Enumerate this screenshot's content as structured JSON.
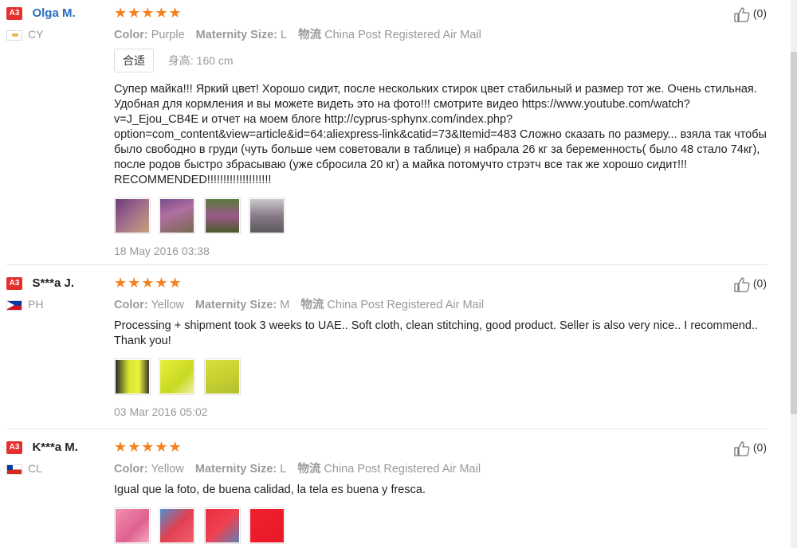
{
  "helpful_label": "(0)",
  "reviews": [
    {
      "badge": "A3",
      "name": "Olga M.",
      "country": "CY",
      "stars": "★★★★★",
      "color_label": "Color:",
      "color_value": "Purple",
      "size_label": "Maternity Size:",
      "size_value": "L",
      "ship_label": "物流",
      "ship_value": "China Post Registered Air Mail",
      "fit_tag": "合适",
      "height_label": "身高:",
      "height_value": "160 cm",
      "text": "Супер майка!!! Яркий цвет! Хорошо сидит, после нескольких стирок цвет стабильный и размер тот же. Очень стильная. Удобная для кормления и вы можете видеть это на фото!!! смотрите видео https://www.youtube.com/watch?v=J_Ejou_CB4E и отчет на моем блоге http://cyprus-sphynx.com/index.php?option=com_content&view=article&id=64:aliexpress-link&catid=73&Itemid=483 Сложно сказать по размеру... взяла так чтобы было свободно в груди (чуть больше чем советовали в таблице) я набрала 26 кг за беременность( было 48 стало 74кг), после родов быстро збрасываю (уже сбросила 20 кг) а майка потомучто стрэтч все так же хорошо сидит!!! RECOMMENDED!!!!!!!!!!!!!!!!!!!!",
      "date": "18 May 2016 03:38"
    },
    {
      "badge": "A3",
      "name": "S***a J.",
      "country": "PH",
      "stars": "★★★★★",
      "color_label": "Color:",
      "color_value": "Yellow",
      "size_label": "Maternity Size:",
      "size_value": "M",
      "ship_label": "物流",
      "ship_value": "China Post Registered Air Mail",
      "text": "Processing + shipment took 3 weeks to UAE.. Soft cloth, clean stitching, good product. Seller is also very nice.. I recommend.. Thank you!",
      "date": "03 Mar 2016 05:02"
    },
    {
      "badge": "A3",
      "name": "K***a M.",
      "country": "CL",
      "stars": "★★★★★",
      "color_label": "Color:",
      "color_value": "Yellow",
      "size_label": "Maternity Size:",
      "size_value": "L",
      "ship_label": "物流",
      "ship_value": "China Post Registered Air Mail",
      "text": "Igual que la foto, de buena calidad, la tela es buena y fresca."
    }
  ],
  "colors": {
    "badge": "#e4312e",
    "stars": "#f58220",
    "name_highlight": "#2a6ebd"
  }
}
